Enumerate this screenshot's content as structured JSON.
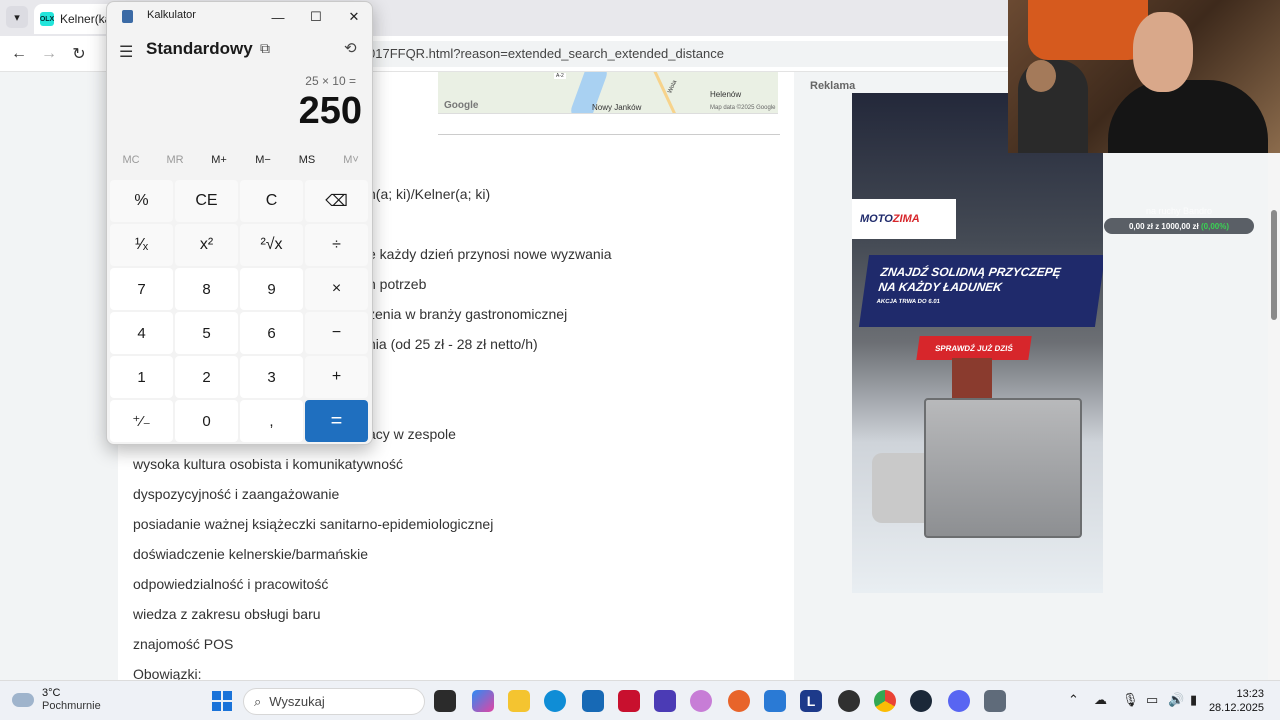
{
  "browser": {
    "tab_title": "Kelner(ka),",
    "tab_favicon": "olx-icon",
    "address": "017FFQR.html?reason=extended_search_extended_distance"
  },
  "map": {
    "labels": {
      "road": "Wola",
      "town1": "Nowy Janków",
      "town2": "Helenów",
      "brand": "Google",
      "copyright": "Map data ©2025 Google",
      "roadnum": "A-2"
    }
  },
  "article": {
    "lines": [
      "n(a; ki)/Kelner(a; ki)",
      "e każdy dzień przynosi nowe wyzwania",
      "h potrzeb",
      "zenia w branży gastronomicznej",
      "nia (od 25 zł - 28 zł netto/h)",
      "acy w zespole",
      "wysoka kultura osobista i komunikatywność",
      "dyspozycyjność i zaangażowanie",
      "posiadanie ważnej książeczki sanitarno-epidemiologicznej",
      "doświadczenie kelnerskie/barmańskie",
      "odpowiedzialność i pracowitość",
      "wiedza z zakresu obsługi baru",
      "znajomość POS",
      "Obowiązki:"
    ]
  },
  "ad": {
    "label": "Reklama",
    "brand_part1": "MOTO",
    "brand_part2": "ZIMA",
    "headline_1": "ZNAJDŹ SOLIDNĄ PRZYCZEPĘ",
    "headline_2": "NA KAŻDY ŁADUNEK",
    "subline": "AKCJA TRWA DO 6.01",
    "cta": "SPRAWDŹ JUŻ DZIŚ"
  },
  "overlay_widget": {
    "title": "na ruchy Bandro",
    "progress_text": "0,00 zł z 1000,00 zł",
    "progress_pct": "(0,00%)",
    "progress_value": 0
  },
  "calculator": {
    "window_title": "Kalkulator",
    "mode": "Standardowy",
    "expression": "25 × 10 =",
    "result": "250",
    "memory": [
      "MC",
      "MR",
      "M+",
      "M−",
      "MS",
      "M˅"
    ],
    "memory_disabled": [
      true,
      true,
      false,
      false,
      false,
      true
    ],
    "keys": [
      [
        "%",
        "CE",
        "C",
        "⌫"
      ],
      [
        "¹⁄ₓ",
        "x²",
        "²√x",
        "÷"
      ],
      [
        "7",
        "8",
        "9",
        "×"
      ],
      [
        "4",
        "5",
        "6",
        "−"
      ],
      [
        "1",
        "2",
        "3",
        "+"
      ],
      [
        "⁺⁄₋",
        "0",
        ",",
        "="
      ]
    ]
  },
  "taskbar": {
    "weather_temp": "3°C",
    "weather_cond": "Pochmurnie",
    "search_placeholder": "Wyszukaj",
    "time": "13:23",
    "date": "28.12.2025"
  }
}
